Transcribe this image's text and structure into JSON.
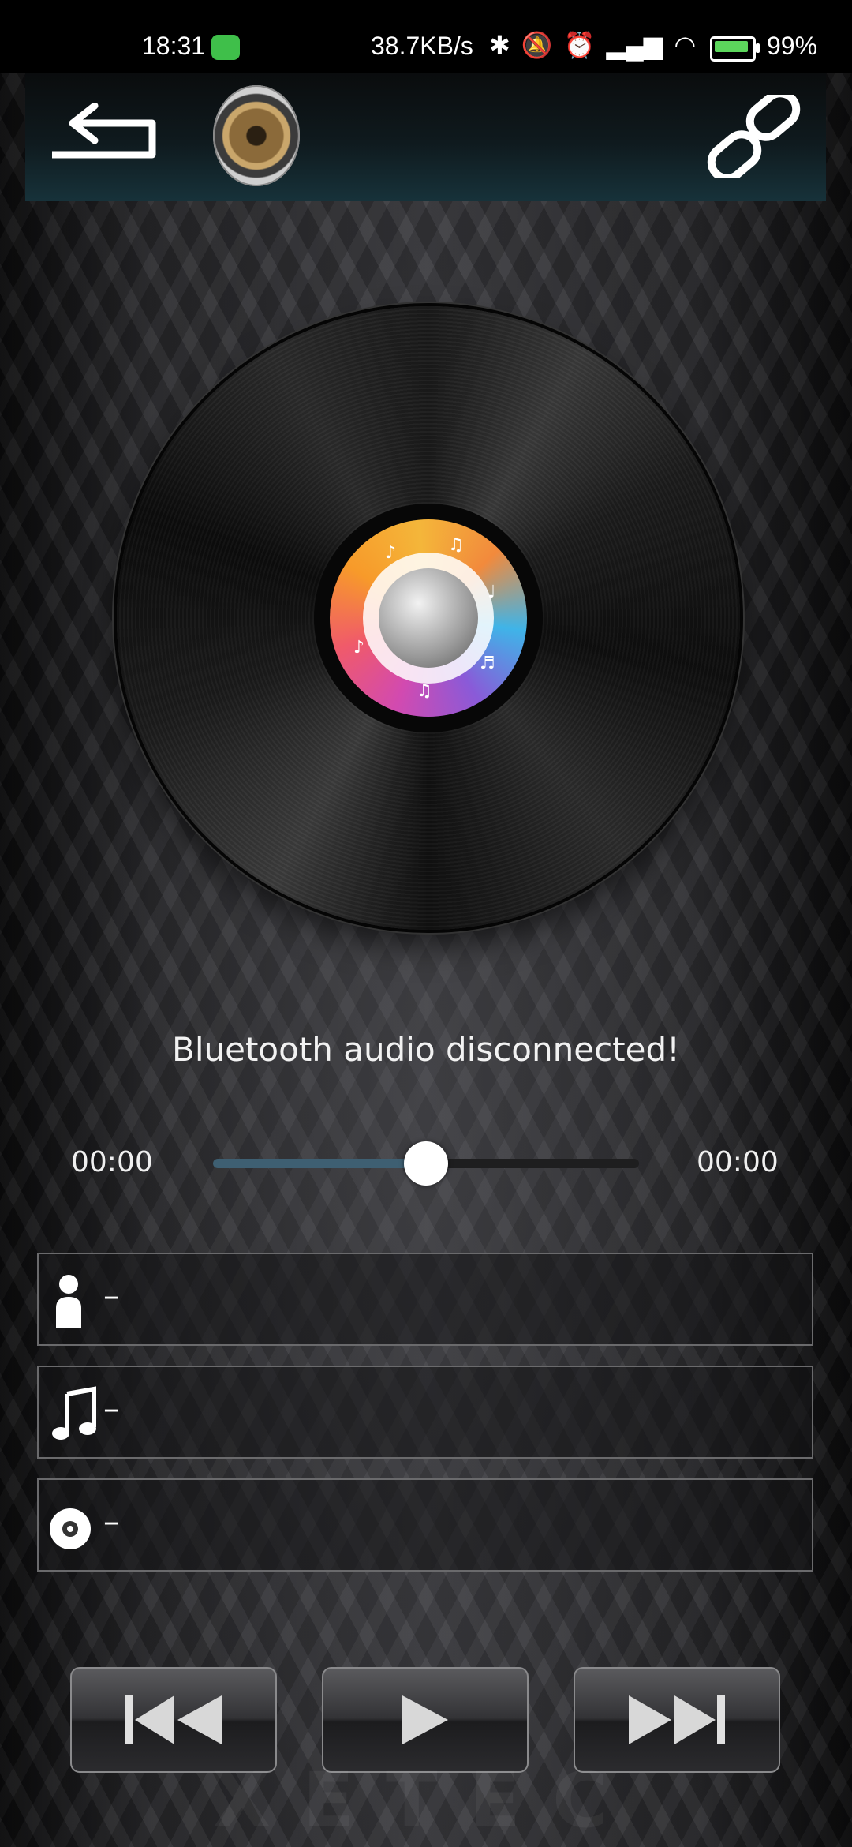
{
  "status_bar": {
    "time": "18:31",
    "network_speed": "38.7KB/s",
    "battery_percent": "99%",
    "icons": [
      "app-notification-icon",
      "bluetooth-icon",
      "mute-icon",
      "alarm-icon",
      "hd-signal-icon",
      "wifi-icon",
      "battery-charging-icon"
    ]
  },
  "header": {
    "back_icon": "back-icon",
    "speaker_icon": "speaker-icon",
    "link_icon": "link-icon"
  },
  "player": {
    "status_message": "Bluetooth audio disconnected!",
    "time_elapsed": "00:00",
    "time_total": "00:00",
    "progress_fraction": 0.5
  },
  "track_info": {
    "artist": "–",
    "title": "–",
    "album": "–"
  },
  "controls": [
    "previous-button",
    "play-button",
    "next-button"
  ],
  "colors": {
    "accent": "#3e5f72",
    "header_bottom": "#17323a",
    "background": "#2a2a2d"
  }
}
